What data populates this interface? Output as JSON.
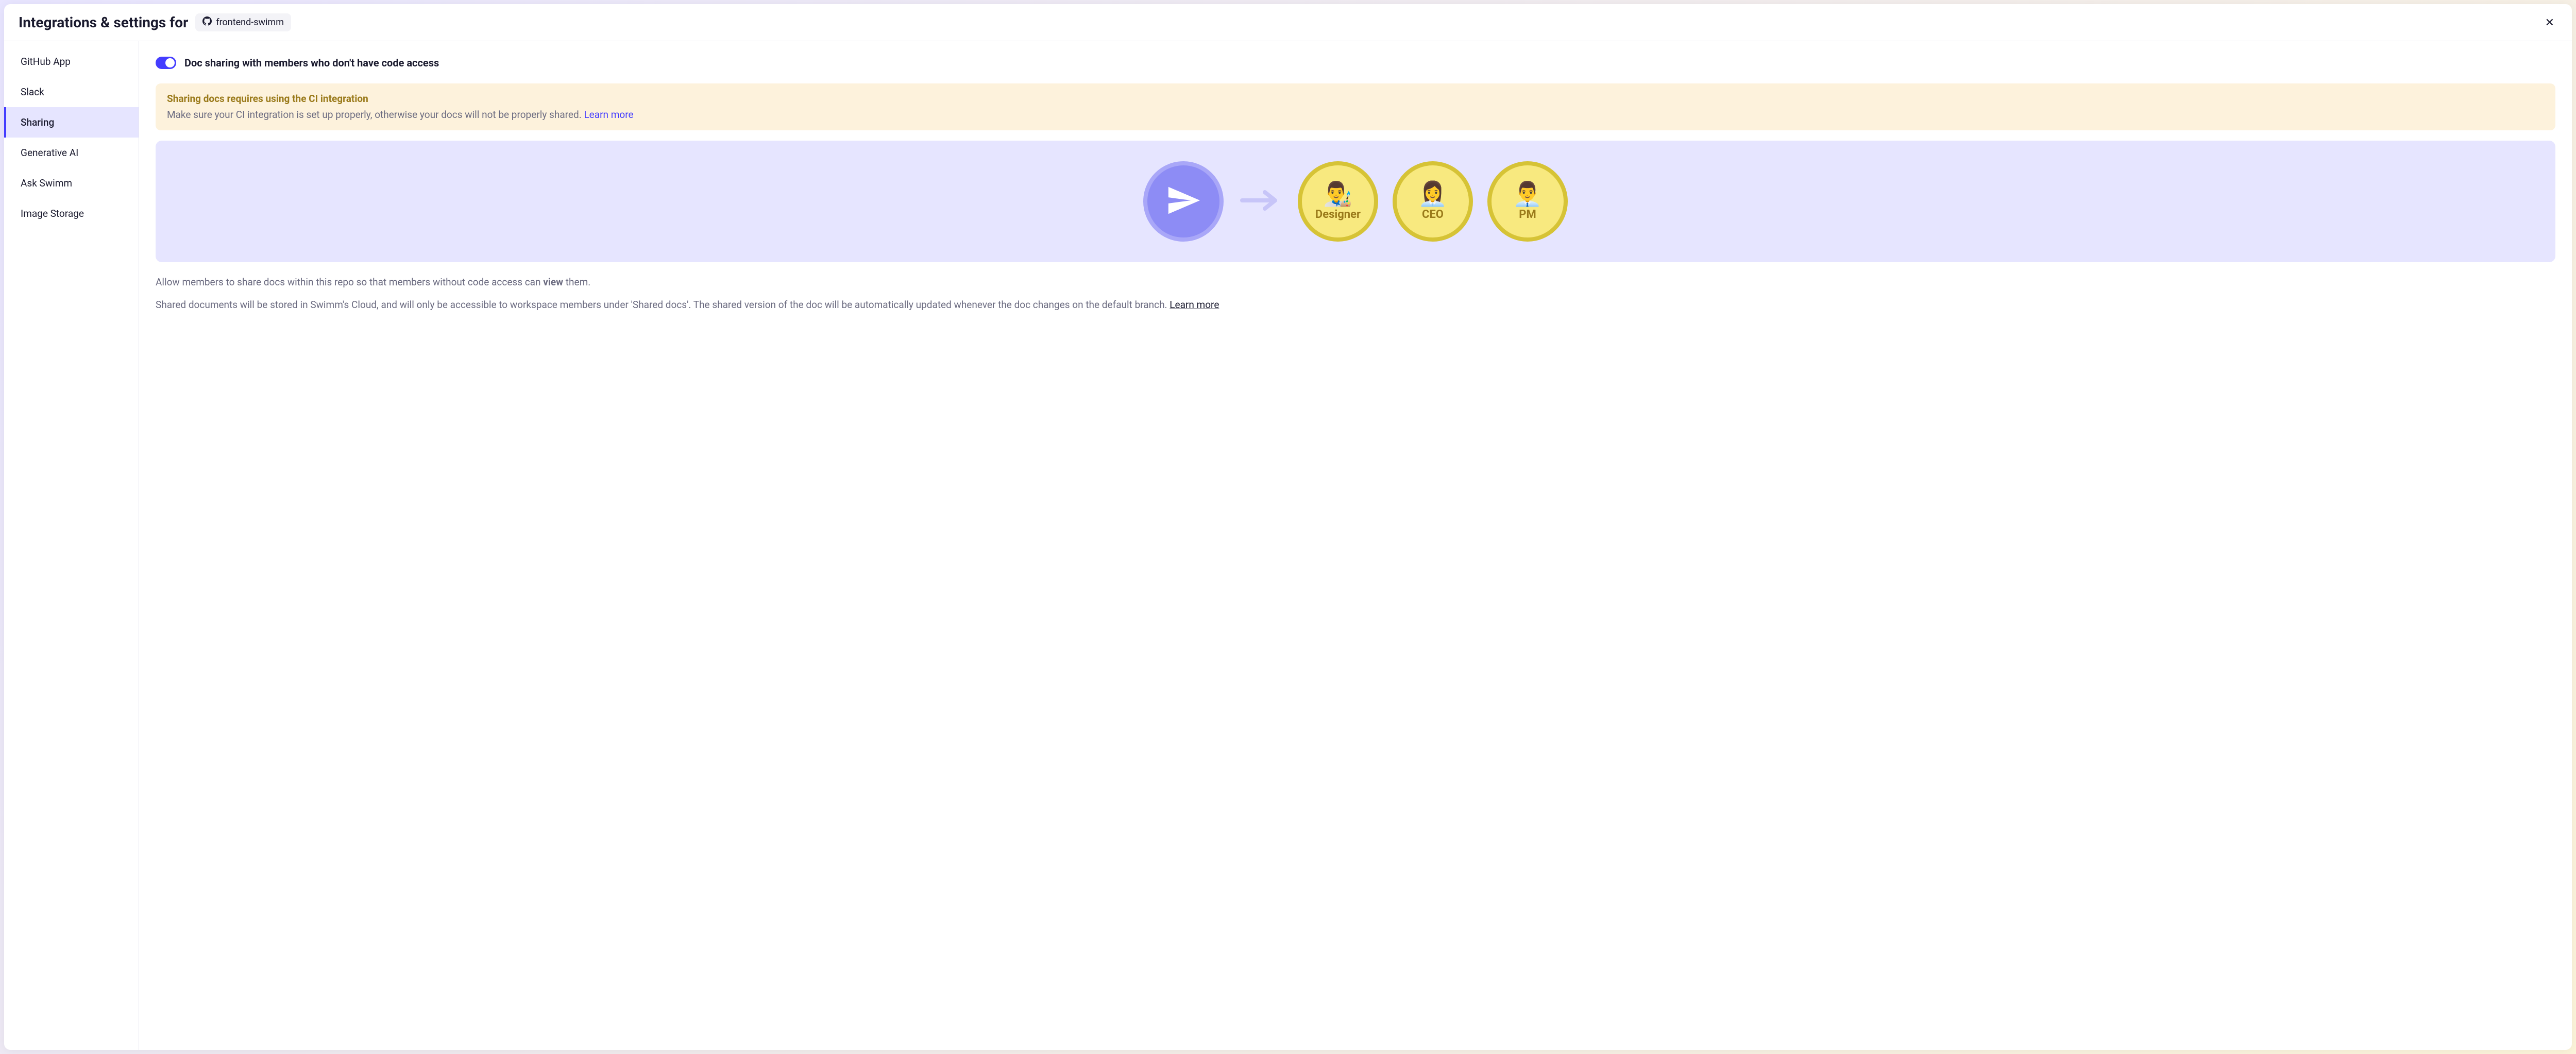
{
  "header": {
    "title": "Integrations & settings for",
    "repo_name": "frontend-swimm"
  },
  "sidebar": {
    "items": [
      {
        "label": "GitHub App",
        "active": false
      },
      {
        "label": "Slack",
        "active": false
      },
      {
        "label": "Sharing",
        "active": true
      },
      {
        "label": "Generative AI",
        "active": false
      },
      {
        "label": "Ask Swimm",
        "active": false
      },
      {
        "label": "Image Storage",
        "active": false
      }
    ]
  },
  "sharing": {
    "toggle_on": true,
    "toggle_label": "Doc sharing with members who don't have code access",
    "warning": {
      "title": "Sharing docs requires using the CI integration",
      "body_prefix": "Make sure your CI integration is set up properly, otherwise your docs will not be properly shared. ",
      "learn_more": "Learn more"
    },
    "roles": [
      {
        "emoji": "👨‍🎨",
        "label": "Designer"
      },
      {
        "emoji": "👩‍💼",
        "label": "CEO"
      },
      {
        "emoji": "👨‍💼",
        "label": "PM"
      }
    ],
    "desc1_prefix": "Allow members to share docs within this repo so that members without code access can ",
    "desc1_bold": "view",
    "desc1_suffix": " them.",
    "desc2_prefix": "Shared documents will be stored in Swimm's Cloud, and will only be accessible to workspace members under 'Shared docs'. The shared version of the doc will be automatically updated whenever the doc changes on the default branch. ",
    "desc2_learn_more": "Learn more"
  }
}
